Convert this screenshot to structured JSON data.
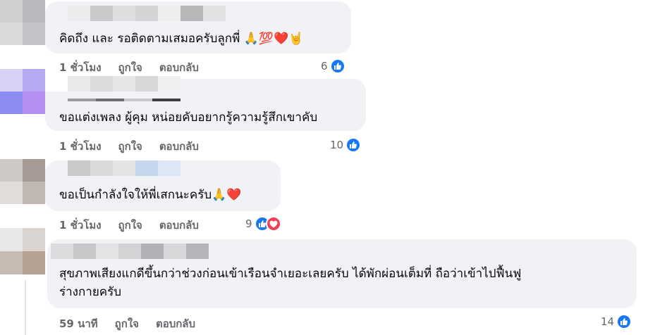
{
  "comments": [
    {
      "text": "คิดถึง และ รอติดตามเสมอครับลูกพี่ 🙏💯❤️🤘",
      "time": "1 ชั่วโมง",
      "like": "ถูกใจ",
      "reply": "ตอบกลับ",
      "reaction_count": "6",
      "reactions": [
        "like-icon"
      ]
    },
    {
      "text": "ขอแต่งเพลง ผู้คุม หน่อยคับอยากรู้ความรู้สึกเขาคับ",
      "time": "1 ชั่วโมง",
      "like": "ถูกใจ",
      "reply": "ตอบกลับ",
      "reaction_count": "10",
      "reactions": [
        "like-icon"
      ]
    },
    {
      "text": "ขอเป็นกำลังใจให้พี่เสกนะครับ🙏❤️",
      "time": "1 ชั่วโมง",
      "like": "ถูกใจ",
      "reply": "ตอบกลับ",
      "reaction_count": "9",
      "reactions": [
        "like-icon",
        "love-icon"
      ]
    },
    {
      "text_line1": "สุขภาพเสียงแกดีขึ้นกว่าช่วงก่อนเข้าเรือนจำเยอะเลยครับ ได้พักผ่อนเต็มที่ ถือว่าเข้าไปฟื้นฟู",
      "text_line2": "ร่างกายครับ",
      "time": "59 นาที",
      "like": "ถูกใจ",
      "reply": "ตอบกลับ",
      "reaction_count": "14",
      "reactions": [
        "like-icon"
      ]
    }
  ],
  "colors": {
    "bubble": "#f0f2f5",
    "secondary_text": "#65676b",
    "like_blue": "#1877f2",
    "love_red": "#f33e58"
  }
}
